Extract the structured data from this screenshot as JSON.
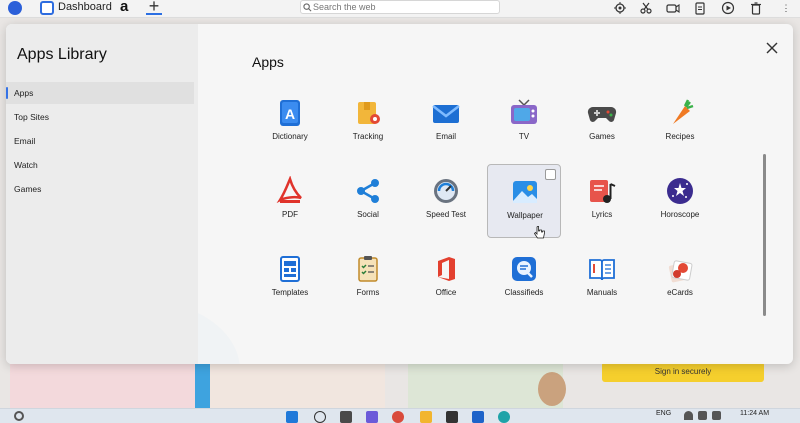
{
  "browser": {
    "tab_label": "Dashboard",
    "amazon_glyph": "a",
    "new_tab_glyph": "+",
    "search_placeholder": "Search the web",
    "toolbar_icons": [
      "extensions-icon",
      "scissors-icon",
      "camera-icon",
      "clipboard-icon",
      "play-icon",
      "trash-icon",
      "more-icon"
    ]
  },
  "background_page": {
    "signin_label": "Sign in securely"
  },
  "taskbar": {
    "lang": "ENG",
    "time": "11:24 AM"
  },
  "modal": {
    "library_title": "Apps Library",
    "apps_heading": "Apps",
    "sidebar_items": [
      {
        "label": "Apps",
        "active": true
      },
      {
        "label": "Top Sites",
        "active": false
      },
      {
        "label": "Email",
        "active": false
      },
      {
        "label": "Watch",
        "active": false
      },
      {
        "label": "Games",
        "active": false
      }
    ],
    "apps": [
      {
        "label": "Dictionary",
        "icon": "dictionary-icon"
      },
      {
        "label": "Tracking",
        "icon": "tracking-icon"
      },
      {
        "label": "Email",
        "icon": "email-icon"
      },
      {
        "label": "TV",
        "icon": "tv-icon"
      },
      {
        "label": "Games",
        "icon": "gamepad-icon"
      },
      {
        "label": "Recipes",
        "icon": "carrot-icon"
      },
      {
        "label": "PDF",
        "icon": "pdf-icon"
      },
      {
        "label": "Social",
        "icon": "share-icon"
      },
      {
        "label": "Speed Test",
        "icon": "speedometer-icon"
      },
      {
        "label": "Wallpaper",
        "icon": "wallpaper-icon",
        "selected": true
      },
      {
        "label": "Lyrics",
        "icon": "music-note-icon"
      },
      {
        "label": "Horoscope",
        "icon": "stars-icon"
      },
      {
        "label": "Templates",
        "icon": "templates-icon"
      },
      {
        "label": "Forms",
        "icon": "forms-icon"
      },
      {
        "label": "Office",
        "icon": "office-icon"
      },
      {
        "label": "Classifieds",
        "icon": "classifieds-icon"
      },
      {
        "label": "Manuals",
        "icon": "manual-icon"
      },
      {
        "label": "eCards",
        "icon": "ecard-icon"
      }
    ]
  }
}
